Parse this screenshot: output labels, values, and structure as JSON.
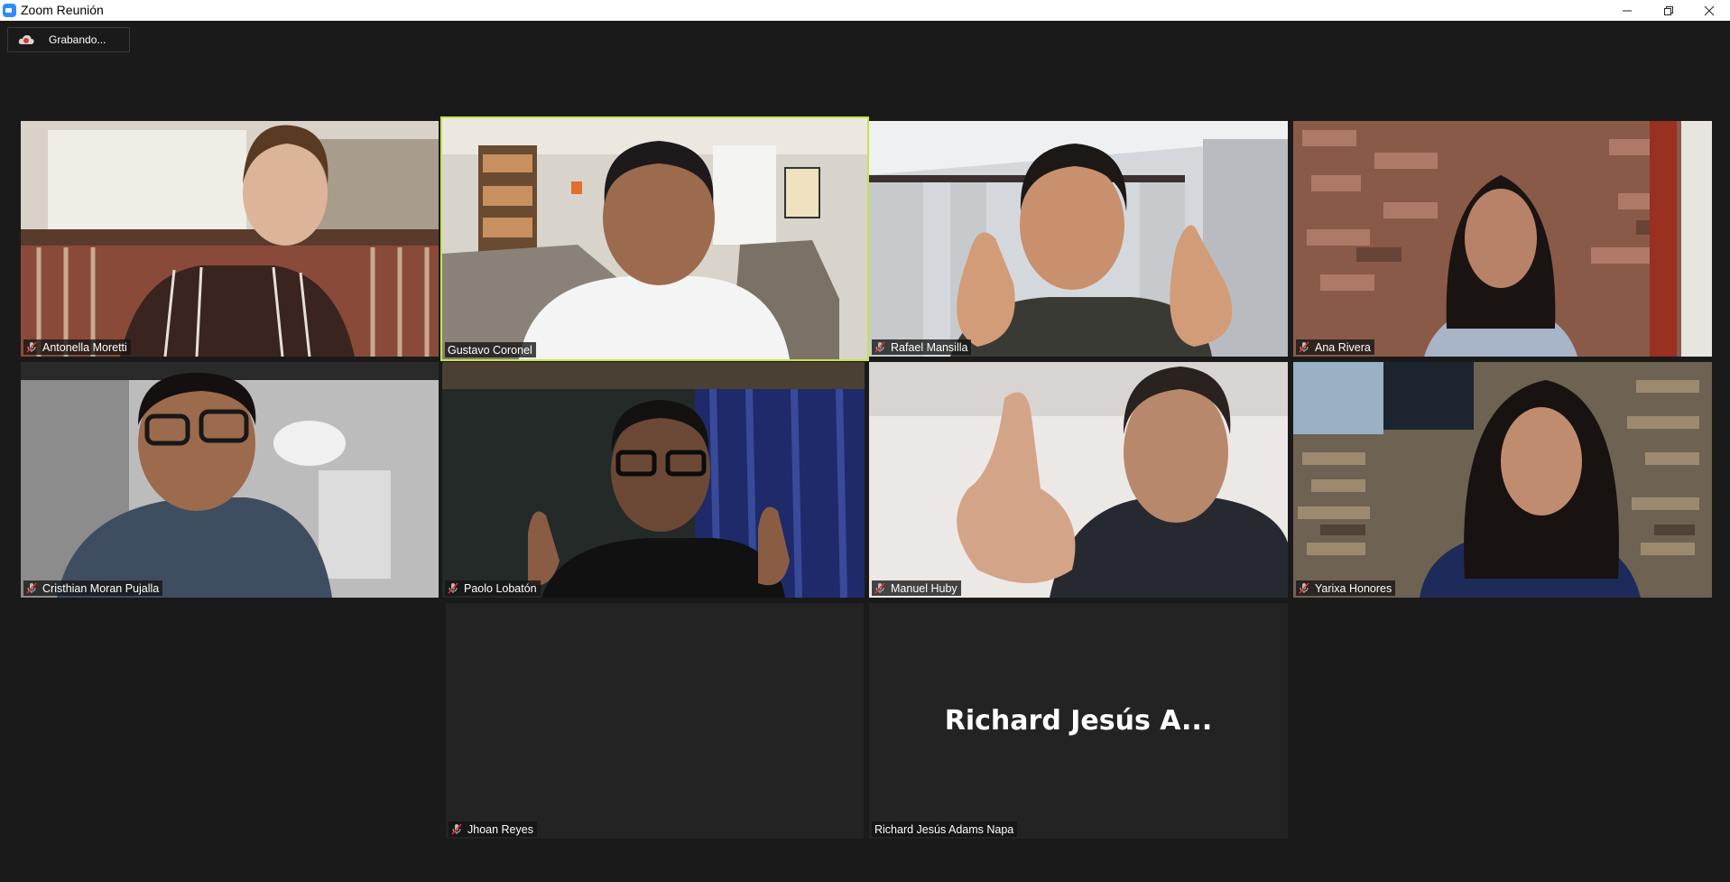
{
  "window": {
    "title": "Zoom Reunión"
  },
  "recording": {
    "label": "Grabando..."
  },
  "colors": {
    "active_speaker": "#c6e44a",
    "mute": "#e0323a",
    "background": "#1a1a1a",
    "tile_empty": "#232323"
  },
  "participants": [
    {
      "name": "Antonella Moretti",
      "muted": true
    },
    {
      "name": "Gustavo Coronel",
      "muted": false,
      "active": true
    },
    {
      "name": "Rafael Mansilla",
      "muted": true
    },
    {
      "name": "Ana Rivera",
      "muted": true
    },
    {
      "name": "Cristhian Moran Pujalla",
      "muted": true
    },
    {
      "name": "Paolo Lobatón",
      "muted": true
    },
    {
      "name": "Manuel Huby",
      "muted": true
    },
    {
      "name": "Yarixa Honores",
      "muted": true
    },
    {
      "name": "Jhoan Reyes",
      "muted": true,
      "video": false
    },
    {
      "name": "Richard Jesús Adams Napa",
      "display_name": "Richard Jesús A...",
      "muted": false,
      "video": false
    }
  ]
}
